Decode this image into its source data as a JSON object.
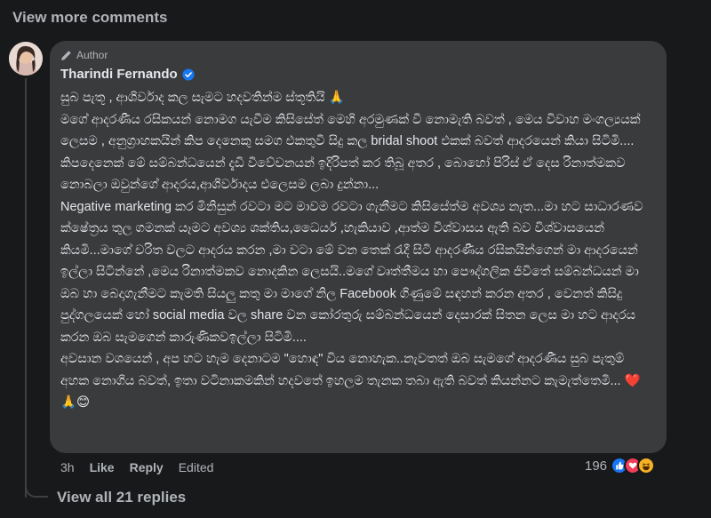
{
  "view_more_comments": "View more comments",
  "comment": {
    "author_badge": "Author",
    "author_name": "Tharindi Fernando",
    "paragraphs": [
      "සුබ පැතූ , ආශිර්වාද කල සැමට හදවතින්ම ස්තූතියි 🙏",
      "මගේ ආදරණීය රසිකයන් නොමග යැවීම කිසිසේත් මෙහි අරමුණක් වී නොමැති බවත් , මෙය විවාහ මංගල්‍යයක් ලෙසම , අනුග්‍රාහකයින් කිප දෙනෙකු සමග එකතුවී සිදු කල bridal shoot එකක් බවත් ආදරයෙන් කියා සිටිමි....",
      "කිපදෙනෙක් මේ සම්බන්ධයෙන් දැඩි විවේචනයන් ඉදිරිපත් කර තිබූ අතර , බොහෝ පිරිස් ඒ දෙස රිනාත්මකව නොබලා ඔවුන්ගේ ආදරය,ආශිර්වාදය එලෙසම ලබා දුන්නා...",
      "Negative marketing කර මිනිසුන් රවටා මට මාවම රවටා ගැනීමට කිසිසේත්ම අවශ්‍ය නැත...මා හට සාධාරණව ක්ෂේත්‍රය තුල ගමනක් යෑමට අවශ්‍ය ශක්තිය,ධෛර්ය ,හැකියාව ,ආත්ම විශ්වාසය ඇති බව විශ්වාසයෙන් කියමි...මාගේ චරිත වලට ආදරය කරන ,මා වටා මේ වන තෙක් රැදී සිටි ආදරණීය රසිකයින්ගෙන් මා ආදරයෙන් ඉල්ලා සිටින්නේ ,මෙය රිනාත්මකව නොදකින ලෙසයි..මගේ වෘත්තීමය හා පෞද්ගලික ජිවිතේ සම්බන්ධයන් මා ඔබ හා බෙදාගැනීමට කැමති සියලු කතු මා මාගේ නිල Facebook ගිණුමේ සඳහන් කරන අතර , වෙනත් කිසිදු පුද්ගලයෙක් හෝ social media වල share වන කෝරතුරු සම්බන්ධයෙන් දෙසාරක් සිතන ලෙස මා හට ආදරය කරන ඔබ සැමගෙන් කාරුණිකවඉල්ලා සිටිමි....",
      "අවසාන වශයෙන් , අප හට හැම දෙනාටම \"හොඳ\" විය නොහැක..නැවතත් ඔබ සැමගේ ආදරණීය සුබ පැතුම් අහක නොගිය බවත්, ඉතා වටිනාකමකින් හදවතේ ඉහලම තැනක තබා ඇති බවත් කියන්නට කැමැත්තෙමි... ❤️🙏😊"
    ]
  },
  "actions": {
    "time": "3h",
    "like": "Like",
    "reply": "Reply",
    "edited": "Edited"
  },
  "reactions": {
    "count": "196",
    "icons": [
      "like-icon",
      "love-icon",
      "haha-icon"
    ]
  },
  "view_all_replies": "View all 21 replies",
  "colors": {
    "background": "#18191a",
    "bubble": "#3a3b3c",
    "text": "#e4e6eb",
    "muted": "#b0b3b8",
    "verified": "#1877f2"
  }
}
